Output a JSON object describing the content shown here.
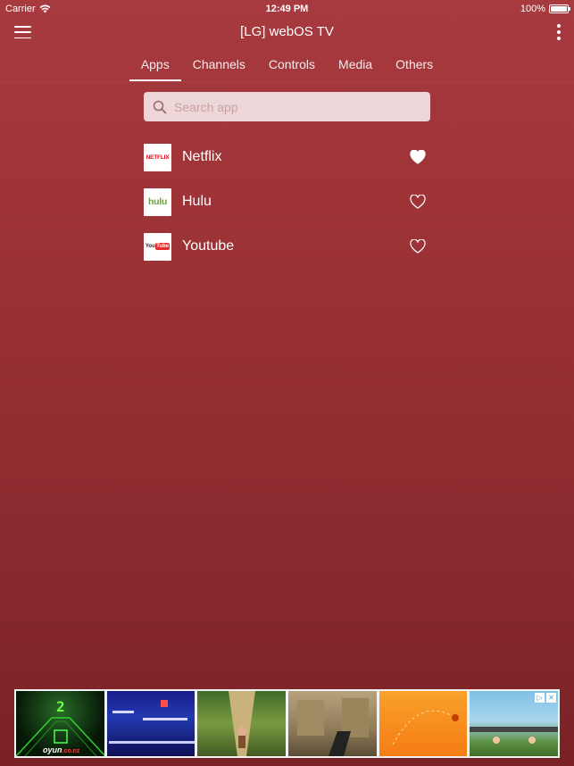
{
  "status_bar": {
    "carrier": "Carrier",
    "time": "12:49 PM",
    "battery_percent": "100%",
    "battery_level": 1.0
  },
  "header": {
    "title": "[LG] webOS TV",
    "menu_icon": "hamburger-menu-icon",
    "more_icon": "vertical-dots-icon"
  },
  "tabs": [
    {
      "label": "Apps",
      "active": true
    },
    {
      "label": "Channels",
      "active": false
    },
    {
      "label": "Controls",
      "active": false
    },
    {
      "label": "Media",
      "active": false
    },
    {
      "label": "Others",
      "active": false
    }
  ],
  "search": {
    "placeholder": "Search app",
    "value": "",
    "icon": "search-icon"
  },
  "apps": [
    {
      "name": "Netflix",
      "logo_text": "NETFLIX",
      "favorite": true
    },
    {
      "name": "Hulu",
      "logo_text": "hulu",
      "favorite": false
    },
    {
      "name": "Youtube",
      "logo_text_a": "You",
      "logo_text_b": "Tube",
      "favorite": false
    }
  ],
  "ad": {
    "brand": "oyun",
    "brand_suffix": ".co.nz",
    "tile1_number": "2",
    "adchoices_icon": "adchoices-icon",
    "close_icon": "close-icon"
  },
  "colors": {
    "background_top": "#a73a3e",
    "background_bottom": "#7b2226",
    "search_bg": "#edd6d7",
    "netflix_red": "#e50914",
    "hulu_green": "#66aa33",
    "youtube_red": "#e52d27"
  }
}
